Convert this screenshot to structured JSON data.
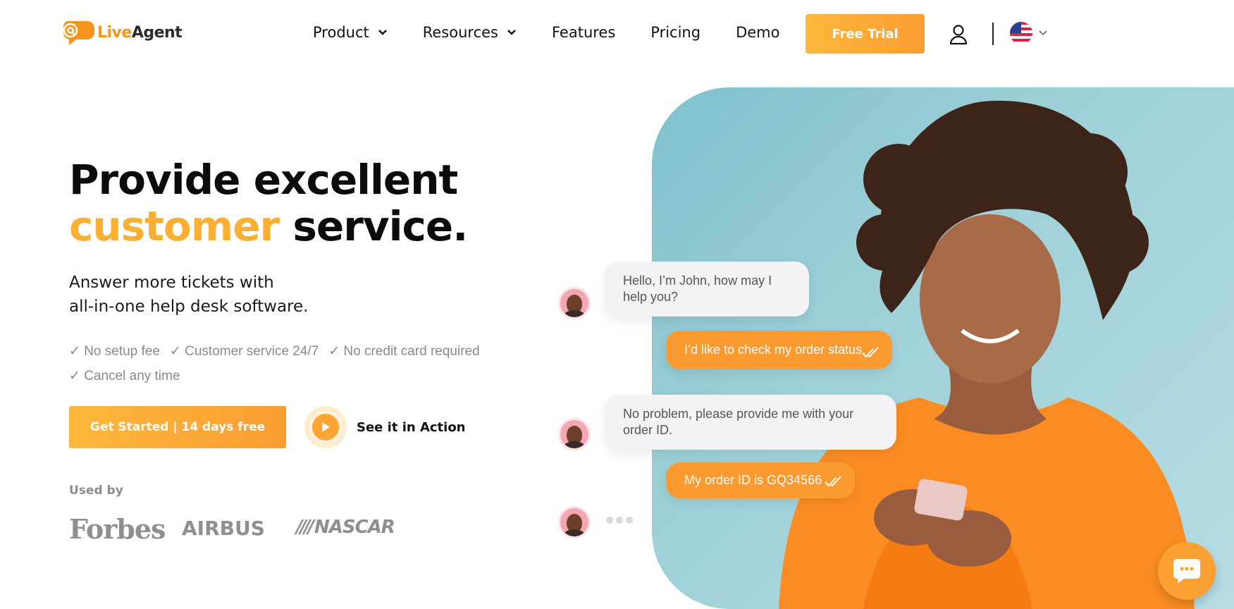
{
  "brand": {
    "live": "Live",
    "agent": "Agent",
    "accent_color": "#f7941d"
  },
  "nav": {
    "items": [
      {
        "label": "Product",
        "has_dropdown": true
      },
      {
        "label": "Resources",
        "has_dropdown": true
      },
      {
        "label": "Features",
        "has_dropdown": false
      },
      {
        "label": "Pricing",
        "has_dropdown": false
      },
      {
        "label": "Demo",
        "has_dropdown": false
      }
    ],
    "cta": "Free Trial",
    "user_icon": "user-icon",
    "language_icon": "us-flag-icon"
  },
  "hero": {
    "title_line1": "Provide excellent",
    "title_accent": "customer",
    "title_rest": " service.",
    "subtitle_line1": "Answer more tickets with",
    "subtitle_line2": "all-in-one help desk software.",
    "checks": [
      "✓ No setup fee",
      "✓ Customer service 24/7",
      "✓ No credit card required",
      "✓ Cancel any time"
    ],
    "primary_cta": "Get Started | 14 days free",
    "secondary_cta": "See it in Action",
    "used_by_label": "Used by",
    "logos": {
      "forbes": "Forbes",
      "airbus": "AIRBUS",
      "nascar": "NASCAR",
      "nascar_bars": "////"
    }
  },
  "chat": {
    "messages": [
      {
        "from": "agent",
        "text": "Hello, I’m John, how may I help you?"
      },
      {
        "from": "user",
        "text": "I’d like to check my order status."
      },
      {
        "from": "agent",
        "text": "No problem, please provide me with your order ID."
      },
      {
        "from": "user",
        "text": "My order ID is GQ34566"
      }
    ]
  },
  "colors": {
    "orange": "#fc9a32",
    "yellow": "#fbb034",
    "teal": "#9fd0d8"
  }
}
